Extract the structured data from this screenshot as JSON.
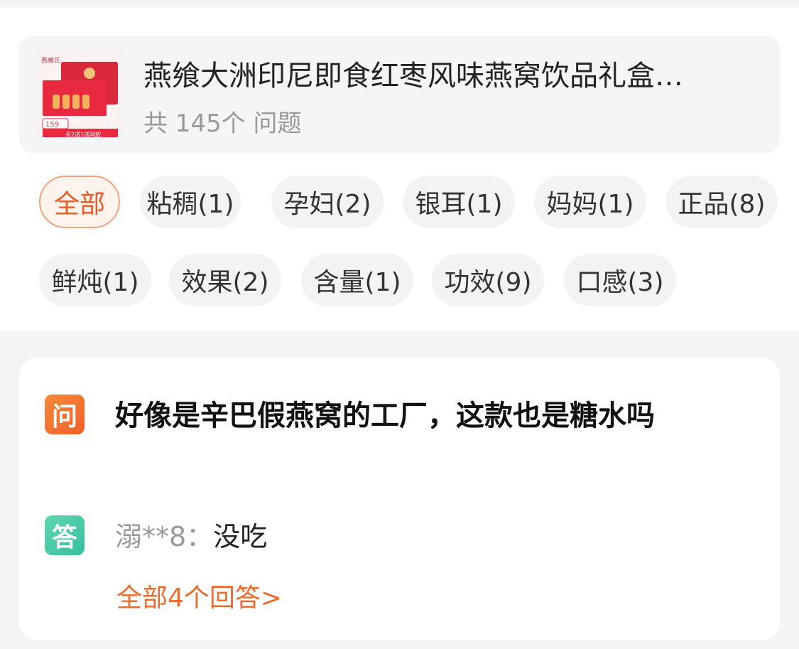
{
  "product": {
    "title": "燕飨大洲印尼即食红枣风味燕窝饮品礼盒…",
    "count_text": "共 145个 问题",
    "thumb_brand": "燕飨氏",
    "thumb_price": "159",
    "thumb_promo": "买2送1送同款"
  },
  "tags": [
    {
      "label": "全部",
      "active": true
    },
    {
      "label": "粘稠(1)"
    },
    {
      "label": "孕妇(2)"
    },
    {
      "label": "银耳(1)"
    },
    {
      "label": "妈妈(1)"
    },
    {
      "label": "正品(8)"
    },
    {
      "label": "鲜炖(1)"
    },
    {
      "label": "效果(2)"
    },
    {
      "label": "含量(1)"
    },
    {
      "label": "功效(9)"
    },
    {
      "label": "口感(3)"
    }
  ],
  "qa": {
    "q_badge": "问",
    "a_badge": "答",
    "question": "好像是辛巴假燕窝的工厂，这款也是糖水吗",
    "answer_user": "溺**8：",
    "answer_text": "没吃",
    "more_link": "全部4个回答>"
  }
}
